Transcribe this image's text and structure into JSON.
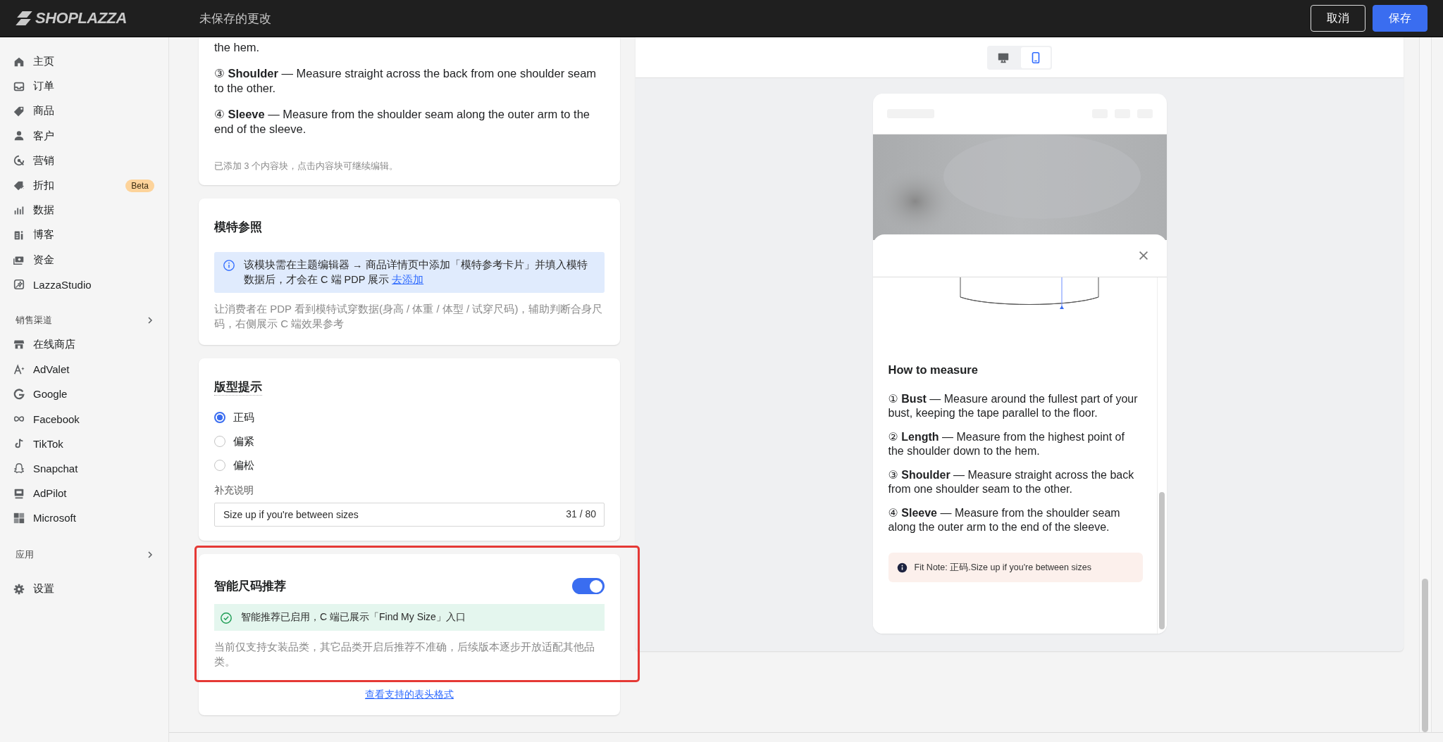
{
  "header": {
    "logo": "SHOPLAZZA",
    "status": "未保存的更改",
    "buttons": [
      {
        "label": "取消",
        "kind": "secondary"
      },
      {
        "label": "保存",
        "kind": "primary"
      }
    ]
  },
  "sidebar": {
    "main": [
      {
        "label": "主页"
      },
      {
        "label": "订单"
      },
      {
        "label": "商品"
      },
      {
        "label": "客户"
      },
      {
        "label": "营销"
      },
      {
        "label": "折扣",
        "badge": "Beta"
      },
      {
        "label": "数据"
      },
      {
        "label": "博客"
      },
      {
        "label": "资金"
      },
      {
        "label": "LazzaStudio"
      }
    ],
    "channels": {
      "title": "销售渠道",
      "items": [
        {
          "label": "在线商店"
        },
        {
          "label": "AdValet"
        },
        {
          "label": "Google"
        },
        {
          "label": "Facebook"
        },
        {
          "label": "TikTok"
        },
        {
          "label": "Snapchat"
        },
        {
          "label": "AdPilot"
        },
        {
          "label": "Microsoft"
        }
      ]
    },
    "apps": {
      "title": "应用"
    },
    "settings": {
      "label": "设置"
    }
  },
  "content_card": {
    "paragraphs": [
      "the hem.",
      "③ **Shoulder** — Measure straight across the back from one shoulder seam to the other.",
      "④ **Sleeve** — Measure from the shoulder seam along the outer arm to the end of the sleeve."
    ],
    "note": "已添加 3 个内容块，点击内容块可继续编辑。"
  },
  "model_card": {
    "title": "模特参照",
    "info": {
      "text": "该模块需在主题编辑器 → 商品详情页中添加「模特参考卡片」并填入模特数据后，才会在 C 端 PDP 展示",
      "link": "去添加"
    },
    "description": "让消费者在 PDP 看到模特试穿数据(身高 / 体重 / 体型 / 试穿尺码)，辅助判断合身尺码，右侧展示 C 端效果参考"
  },
  "fit_card": {
    "title": "版型提示",
    "options": [
      {
        "label": "正码",
        "selected": true
      },
      {
        "label": "偏紧",
        "selected": false
      },
      {
        "label": "偏松",
        "selected": false
      }
    ],
    "note_label": "补充说明",
    "note": {
      "value": "Size up if you're between sizes",
      "counter": "31 / 80"
    }
  },
  "smart_card": {
    "title": "智能尺码推荐",
    "enabled": true,
    "highlighted": true,
    "status": "智能推荐已启用，C 端已展示「Find My Size」入口",
    "description": "当前仅支持女装品类，其它品类开启后推荐不准确，后续版本逐步开放适配其他品类。",
    "link": "查看支持的表头格式"
  },
  "preview": {
    "devices": [
      {
        "selected": false
      },
      {
        "selected": true
      }
    ],
    "sheet": {
      "heading": "How to measure",
      "items": [
        "① **Bust** — Measure around the fullest part of your bust, keeping the tape parallel to the floor.",
        "② **Length** — Measure from the highest point of the shoulder down to the hem.",
        "③ **Shoulder** — Measure straight across the back from one shoulder seam to the other.",
        "④ **Sleeve** — Measure from the shoulder seam along the outer arm to the end of the sleeve."
      ],
      "fit_note": "Fit Note: 正码.Size up if you're between sizes"
    }
  }
}
